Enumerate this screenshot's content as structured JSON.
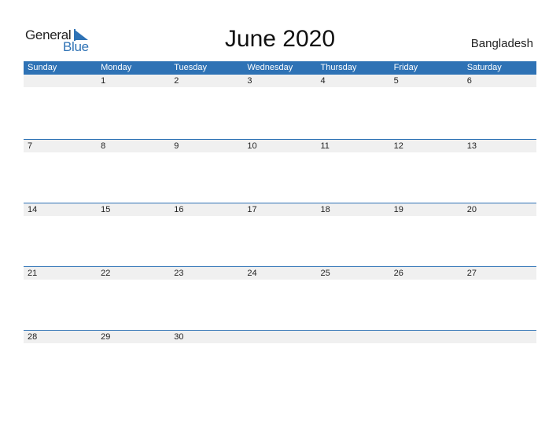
{
  "logo": {
    "general": "General",
    "blue": "Blue"
  },
  "title": "June 2020",
  "country": "Bangladesh",
  "colors": {
    "accent": "#2e72b5",
    "strip": "#f0f0f0"
  },
  "weekdays": [
    "Sunday",
    "Monday",
    "Tuesday",
    "Wednesday",
    "Thursday",
    "Friday",
    "Saturday"
  ],
  "weeks": [
    [
      "",
      "1",
      "2",
      "3",
      "4",
      "5",
      "6"
    ],
    [
      "7",
      "8",
      "9",
      "10",
      "11",
      "12",
      "13"
    ],
    [
      "14",
      "15",
      "16",
      "17",
      "18",
      "19",
      "20"
    ],
    [
      "21",
      "22",
      "23",
      "24",
      "25",
      "26",
      "27"
    ],
    [
      "28",
      "29",
      "30",
      "",
      "",
      "",
      ""
    ]
  ]
}
